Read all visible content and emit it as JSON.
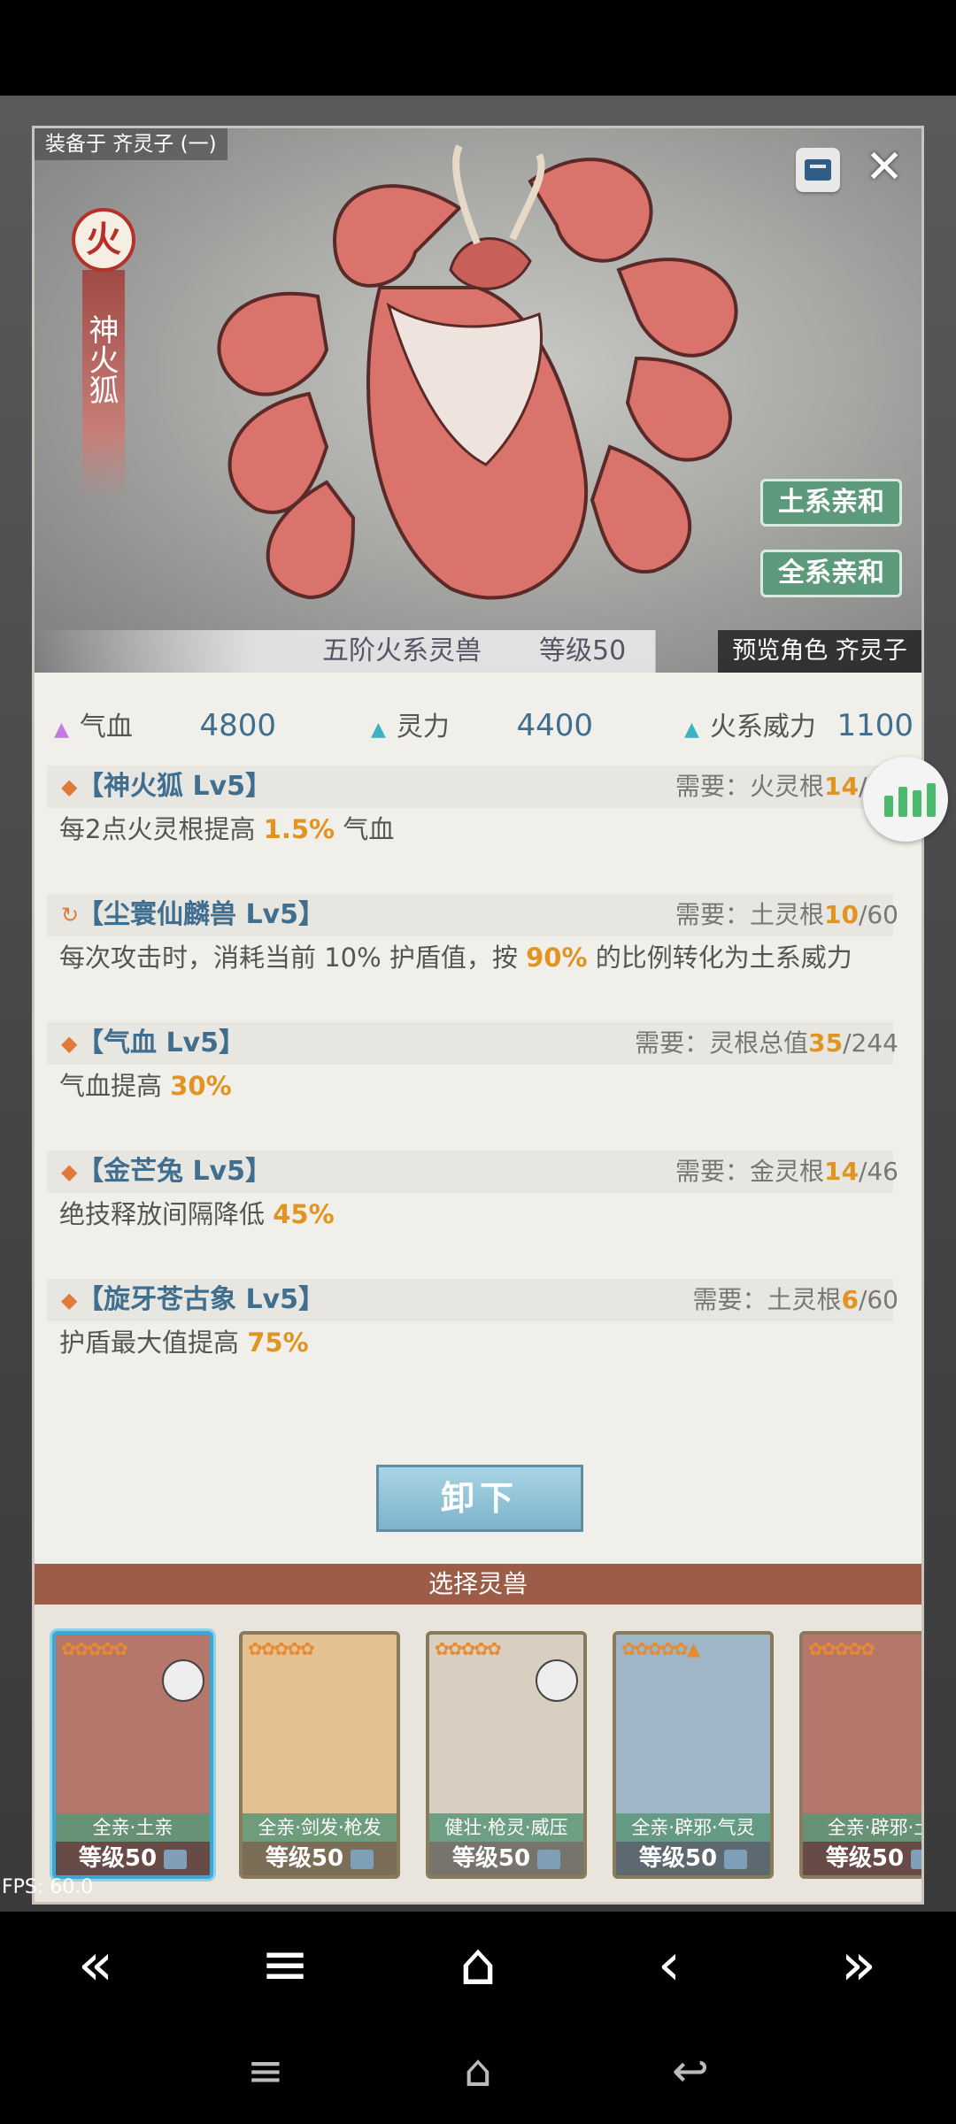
{
  "header": {
    "equipped_to": "装备于 齐灵子 (一)",
    "element": "火",
    "beast_name": "神火狐",
    "affinity_buttons": [
      "土系亲和",
      "全系亲和"
    ],
    "beast_info": "五阶火系灵兽",
    "level": "等级50",
    "preview": "预览角色 齐灵子"
  },
  "stats": [
    {
      "label": "气血",
      "value": "4800",
      "color": "#c37be0"
    },
    {
      "label": "灵力",
      "value": "4400",
      "color": "#3bb3c4"
    },
    {
      "label": "火系威力",
      "value": "1100",
      "color": "#3bb3c4"
    }
  ],
  "skills": [
    {
      "icon": "◆",
      "title": "【神火狐 Lv5】",
      "req_label": "需要：火灵根",
      "req_cur": "14",
      "req_max": "/46",
      "desc_pre": "每2点火灵根提高 ",
      "desc_hl": "1.5%",
      "desc_post": " 气血"
    },
    {
      "icon": "↻",
      "title": "【尘寰仙麟兽 Lv5】",
      "req_label": "需要：土灵根",
      "req_cur": "10",
      "req_max": "/60",
      "desc_pre": "每次攻击时，消耗当前 10% 护盾值，按 ",
      "desc_hl": "90%",
      "desc_post": " 的比例转化为土系威力"
    },
    {
      "icon": "◆",
      "title": "【气血 Lv5】",
      "req_label": "需要：灵根总值",
      "req_cur": "35",
      "req_max": "/244",
      "desc_pre": "气血提高 ",
      "desc_hl": "30%",
      "desc_post": ""
    },
    {
      "icon": "◆",
      "title": "【金芒兔 Lv5】",
      "req_label": "需要：金灵根",
      "req_cur": "14",
      "req_max": "/46",
      "desc_pre": "绝技释放间隔降低 ",
      "desc_hl": "45%",
      "desc_post": ""
    },
    {
      "icon": "◆",
      "title": "【旋牙苍古象 Lv5】",
      "req_label": "需要：土灵根",
      "req_cur": "6",
      "req_max": "/60",
      "desc_pre": "护盾最大值提高 ",
      "desc_hl": "75%",
      "desc_post": ""
    }
  ],
  "unequip_label": "卸下",
  "select_title": "选择灵兽",
  "cards": [
    {
      "stars": "✿✿✿✿✿",
      "tags": "全亲·土亲",
      "level": "等级50",
      "bg": "#b5776c",
      "selected": true
    },
    {
      "stars": "✿✿✿✿✿",
      "tags": "全亲·剑发·枪发",
      "level": "等级50",
      "bg": "#e3c193",
      "selected": false
    },
    {
      "stars": "✿✿✿✿✿",
      "tags": "健壮·枪灵·威压",
      "level": "等级50",
      "bg": "#d8cfc0",
      "selected": false
    },
    {
      "stars": "✿✿✿✿✿▲",
      "tags": "全亲·辟邪·气灵",
      "level": "等级50",
      "bg": "#9fb6c8",
      "selected": false
    },
    {
      "stars": "✿✿✿✿✿",
      "tags": "全亲·辟邪·土",
      "level": "等级50",
      "bg": "#b5776c",
      "selected": false
    }
  ],
  "fps": "FPS: 60.0",
  "nav": [
    "«",
    "≡",
    "⌂",
    "‹",
    "»"
  ],
  "sys": [
    "≡",
    "⌂",
    "↩"
  ]
}
